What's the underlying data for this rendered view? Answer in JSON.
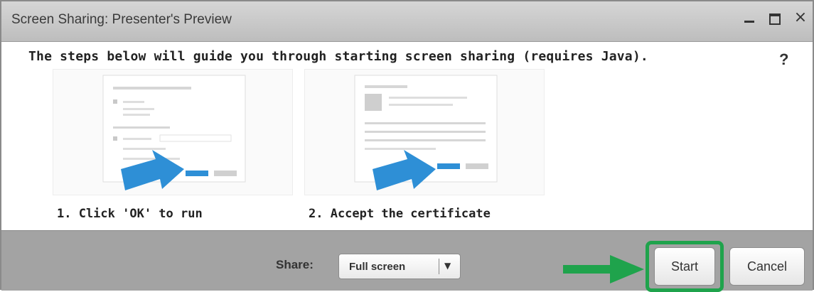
{
  "window": {
    "title": "Screen Sharing: Presenter's Preview",
    "controls": [
      "minimize-icon",
      "maximize-icon",
      "close-icon"
    ],
    "close_glyph": "×"
  },
  "content": {
    "instructions": "The steps below will guide you through starting screen sharing (requires Java).",
    "help_label": "?",
    "steps": [
      {
        "caption": "1. Click 'OK' to run"
      },
      {
        "caption": "2. Accept the certificate"
      }
    ]
  },
  "footer": {
    "share_label": "Share:",
    "share_value": "Full screen",
    "share_caret": "▼",
    "start_label": "Start",
    "cancel_label": "Cancel"
  },
  "colors": {
    "titlebar": "#c8c8c8",
    "footer": "#a3a3a3",
    "step_arrow": "#2e8fd6",
    "highlight": "#1fa34c"
  }
}
